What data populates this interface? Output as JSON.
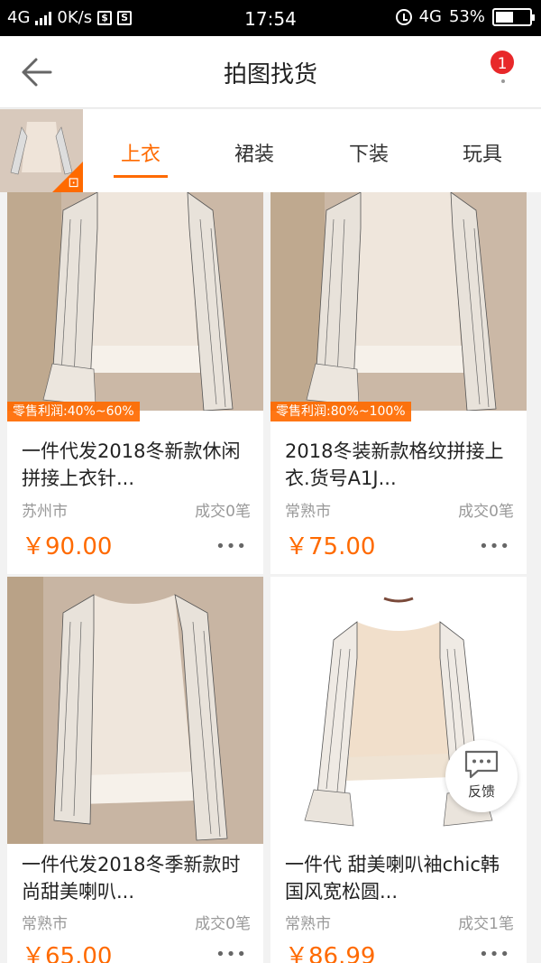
{
  "status_bar": {
    "network": "4G",
    "speed": "0K/s",
    "time": "17:54",
    "net_right": "4G",
    "battery_text": "53%",
    "battery_level": 0.53
  },
  "header": {
    "title": "拍图找货",
    "back_icon": "back-arrow-icon",
    "badge_count": "1"
  },
  "tabs": [
    {
      "label": "上衣",
      "active": true
    },
    {
      "label": "裙装",
      "active": false
    },
    {
      "label": "下装",
      "active": false
    },
    {
      "label": "玩具",
      "active": false
    }
  ],
  "products": [
    {
      "profit": "零售利润:40%~60%",
      "name": "一件代发2018冬新款休闲拼接上衣针...",
      "city": "苏州市",
      "deals": "成交0笔",
      "price": "￥90.00"
    },
    {
      "profit": "零售利润:80%~100%",
      "name": "2018冬装新款格纹拼接上衣.货号A1J...",
      "city": "常熟市",
      "deals": "成交0笔",
      "price": "￥75.00"
    },
    {
      "profit": "",
      "name": "一件代发2018冬季新款时尚甜美喇叭...",
      "city": "常熟市",
      "deals": "成交0笔",
      "price": "￥65.00"
    },
    {
      "profit": "",
      "name": "一件代 甜美喇叭袖chic韩国风宽松圆...",
      "city": "常熟市",
      "deals": "成交1笔",
      "price": "￥86.99"
    }
  ],
  "more_label": "•••",
  "feedback_label": "反馈",
  "colors": {
    "accent": "#ff6a00",
    "badge": "#e8282a"
  }
}
